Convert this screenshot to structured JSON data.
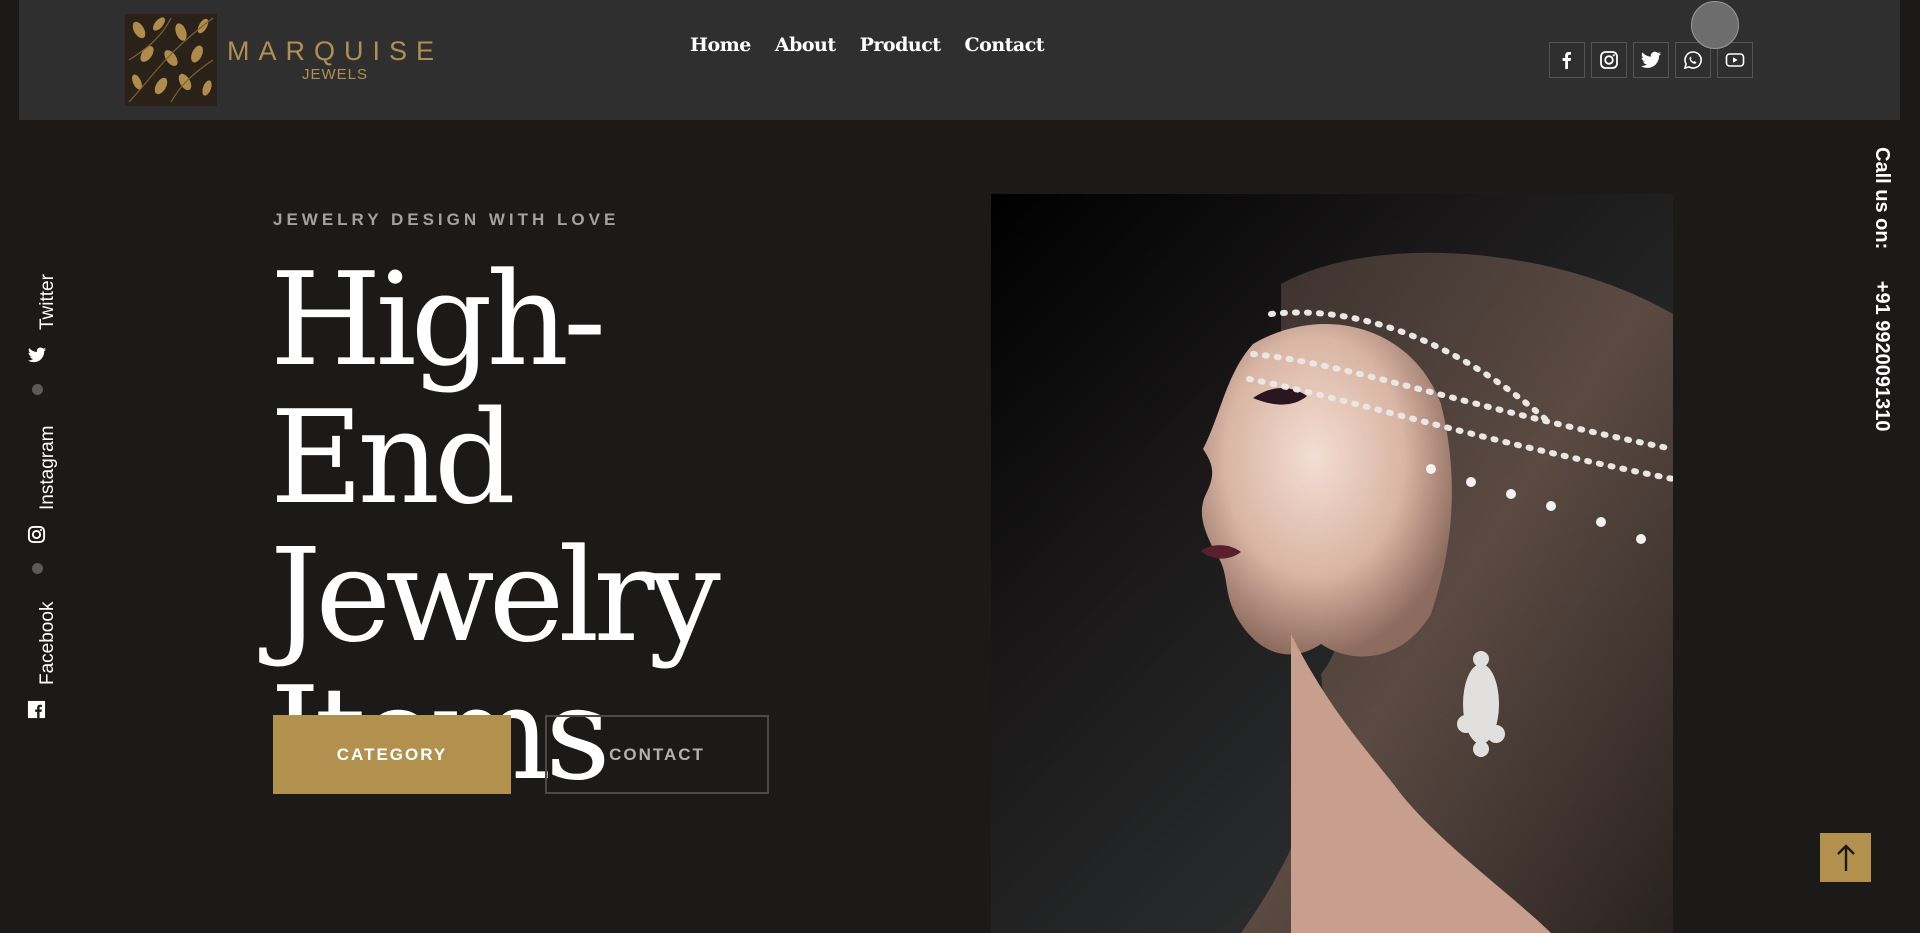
{
  "brand": {
    "name": "MARQUISE",
    "subtitle": "JEWELS",
    "accent": "#b2914f"
  },
  "nav": {
    "items": [
      {
        "label": "Home"
      },
      {
        "label": "About"
      },
      {
        "label": "Product"
      },
      {
        "label": "Contact"
      }
    ]
  },
  "header_socials": [
    "facebook-icon",
    "instagram-icon",
    "twitter-icon",
    "whatsapp-icon",
    "youtube-icon"
  ],
  "side_social": {
    "twitter": "Twitter",
    "instagram": "Instagram",
    "facebook": "Facebook"
  },
  "hero": {
    "eyebrow": "JEWELRY DESIGN WITH LOVE",
    "headline": "High-End Jewelry Items",
    "category_button": "CATEGORY",
    "contact_button": "CONTACT"
  },
  "call": {
    "label": "Call us on:",
    "phone": "+91 9920091310"
  },
  "colors": {
    "background": "#1c1a19",
    "header": "#302f2f",
    "accent": "#b2914f"
  }
}
